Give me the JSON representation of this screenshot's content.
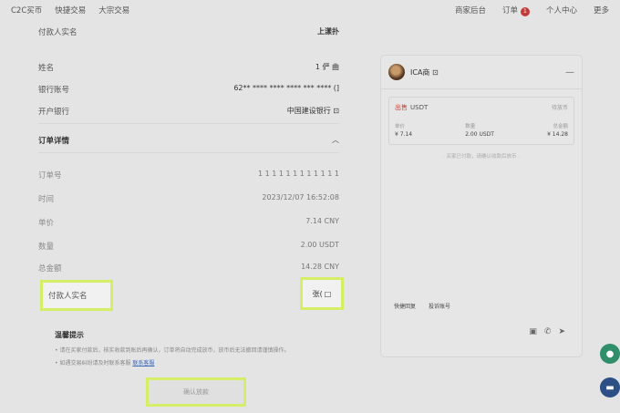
{
  "topnav": {
    "left": [
      "C2C买币",
      "快捷交易",
      "大宗交易"
    ],
    "right": {
      "merchant": "商家后台",
      "orders": "订单",
      "orders_badge": "1",
      "user_center": "个人中心",
      "more": "更多"
    }
  },
  "payment": {
    "payer_label": "付款人实名",
    "payer_value": "上漾扑",
    "name_label": "姓名",
    "name_value": "1 俨 曲",
    "account_label": "银行账号",
    "account_value": "62**  ****  ****  ****  ***  ****  (]",
    "bank_label": "开户银行",
    "bank_value": "中国建设银行 ⊡"
  },
  "order_details": {
    "title": "订单详情",
    "order_no_label": "订单号",
    "order_no_value": "1 1 1 1  1 1 1 1 1 1 1 1",
    "time_label": "时间",
    "time_value": "2023/12/07 16:52:08",
    "price_label": "单价",
    "price_value": "7.14 CNY",
    "qty_label": "数量",
    "qty_value": "2.00 USDT",
    "total_label": "总金额",
    "total_value": "14.28 CNY",
    "payer2_label": "付款人实名",
    "payer2_value": "张(",
    "payer2_copy": "□"
  },
  "tips": {
    "title": "温馨提示",
    "line1": "• 请在买家付款后，核实收款到账后再确认，订单将自动完成放币，放币后无法撤回请谨慎操作。",
    "line2_prefix": "• 如遇交易纠纷请及时联系客服",
    "line2_link": "联系客服"
  },
  "chat": {
    "name": "ICA商 ⊡",
    "minimize": "—",
    "card_buy": "出售",
    "card_asset": "USDT",
    "card_status": "待放币",
    "cols": [
      {
        "k": "单价",
        "v": "¥ 7.14"
      },
      {
        "k": "数量",
        "v": "2.00 USDT"
      },
      {
        "k": "总金额",
        "v": "¥ 14.28"
      }
    ],
    "notice": "· 买家已付款，请确认收款后放币 ·",
    "quick1": "快捷回复",
    "quick2": "投诉账号"
  },
  "confirm_button": "确认放款"
}
